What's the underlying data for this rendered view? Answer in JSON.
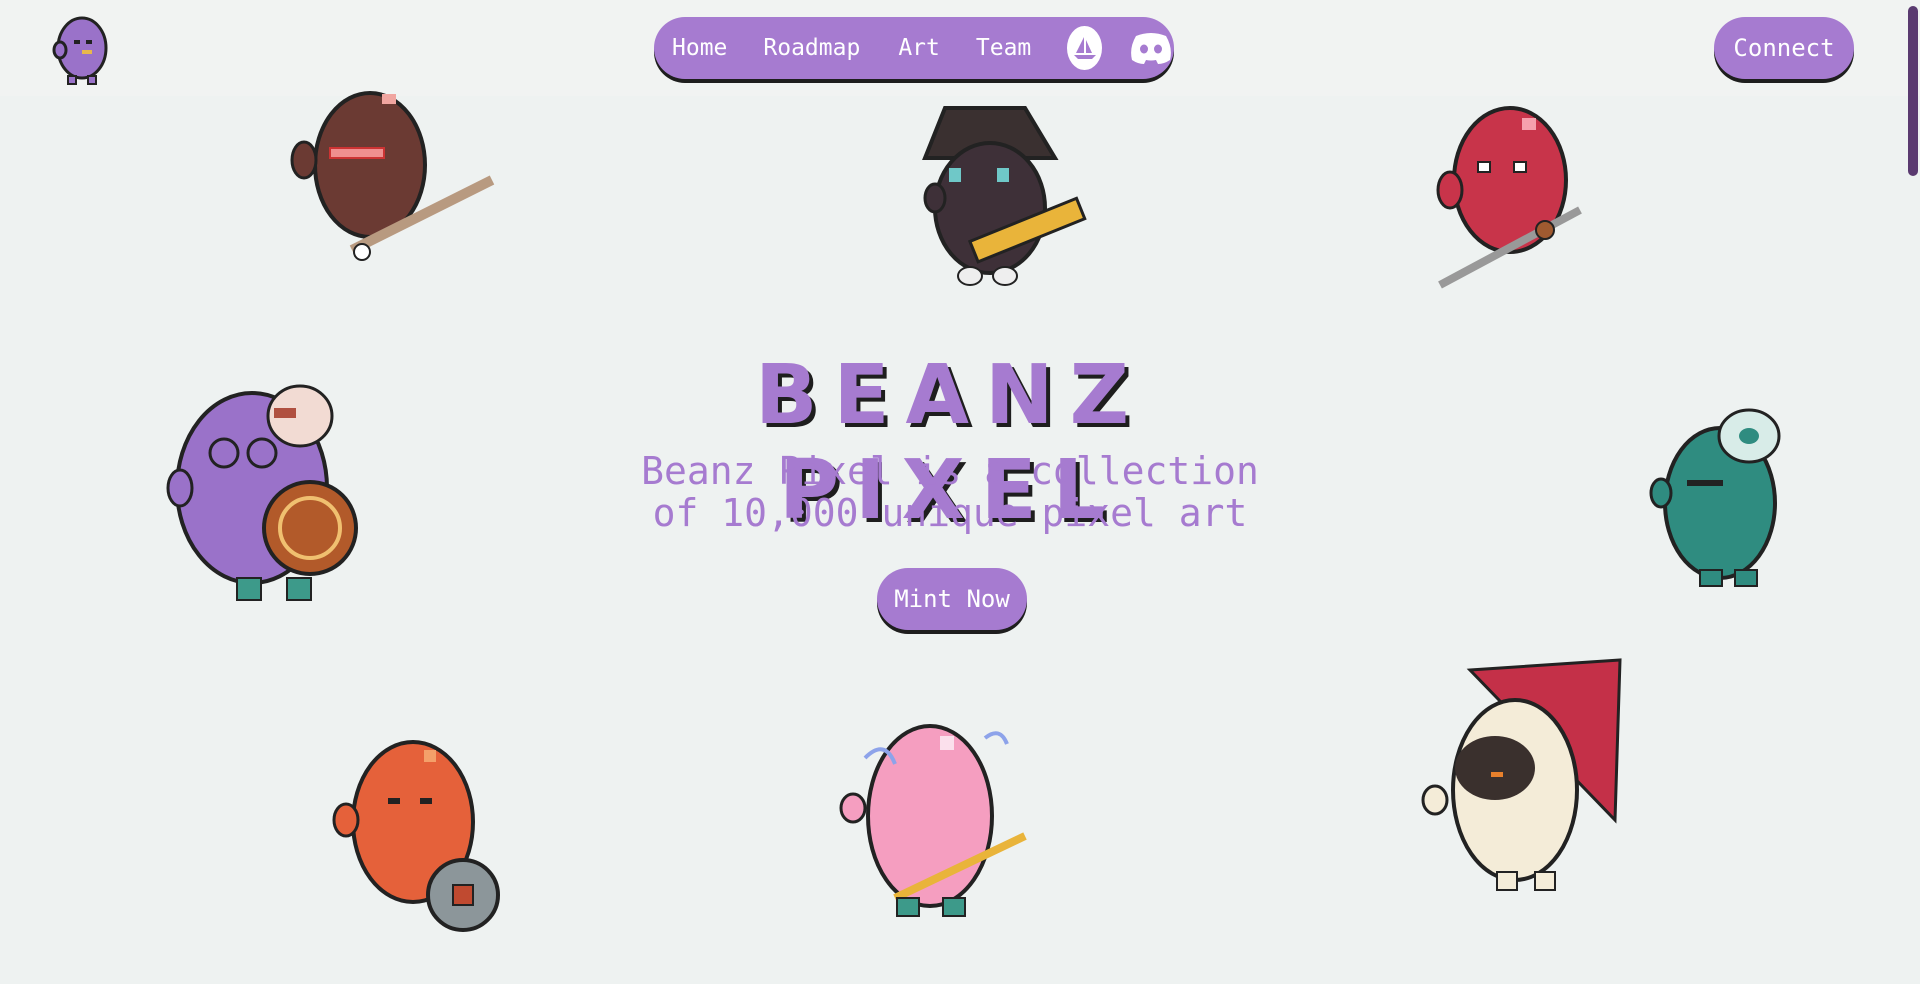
{
  "nav": {
    "items": [
      {
        "label": "Home"
      },
      {
        "label": "Roadmap"
      },
      {
        "label": "Art"
      },
      {
        "label": "Team"
      }
    ],
    "opensea_icon": "opensea-boat-icon",
    "discord_icon": "discord-icon"
  },
  "connect_label": "Connect",
  "hero": {
    "title": "BEANZ PIXEL",
    "subtitle_line1": "Beanz Pixel is a collection",
    "subtitle_line2": "of 10,000 unique pixel art",
    "mint_label": "Mint Now"
  },
  "colors": {
    "accent": "#a67bd0",
    "background": "#eef2f1",
    "outline": "#1e1e1e"
  },
  "characters": [
    "brown-bean-with-sword",
    "dark-bean-with-bucket-hat",
    "red-bean-with-katana",
    "purple-bean-with-shield-and-mask",
    "teal-bean-with-headband",
    "orange-bean-with-coin",
    "pink-bean-with-staff",
    "cream-bean-with-umbrella"
  ]
}
